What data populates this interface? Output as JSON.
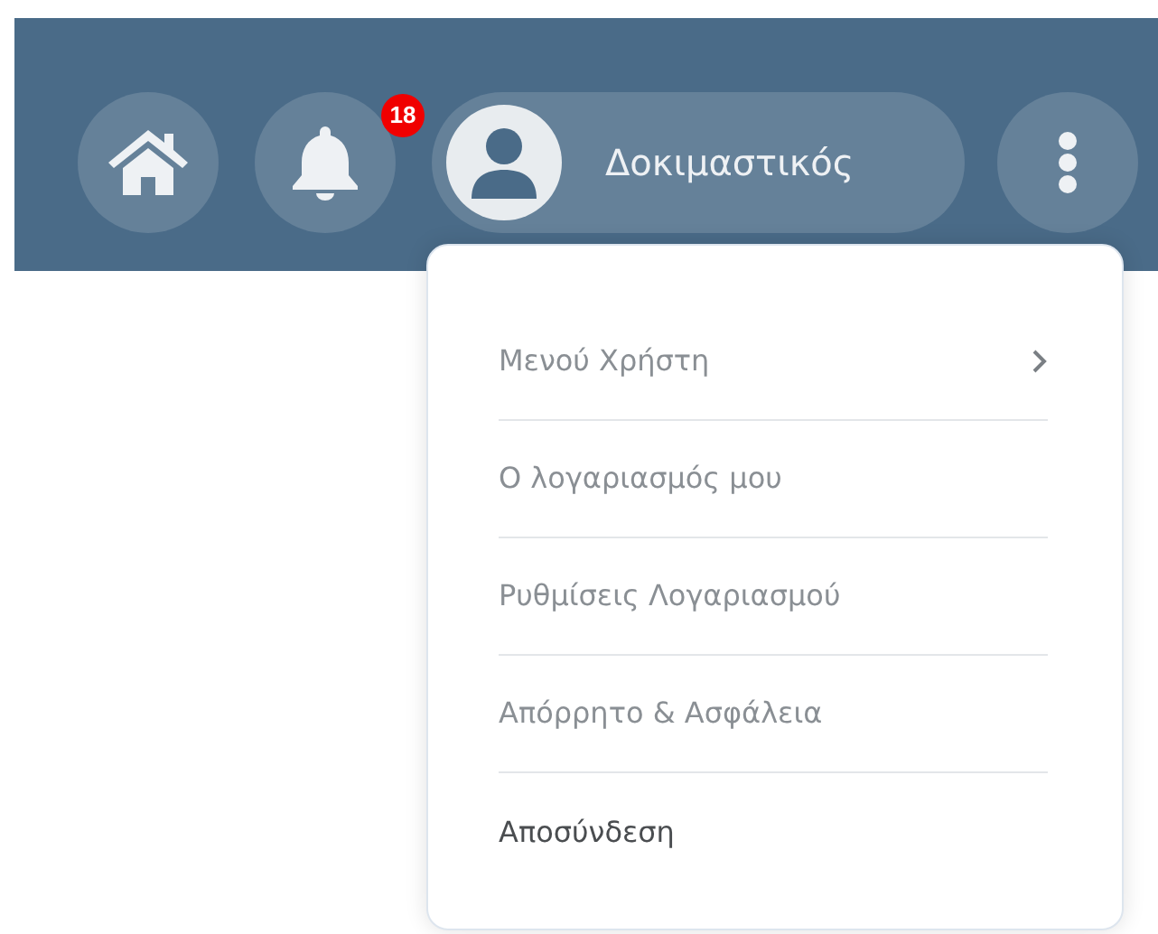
{
  "header": {
    "notifications": {
      "badge": "18"
    },
    "user": {
      "name": "Δοκιμαστικός"
    }
  },
  "user_menu": {
    "expanded": true,
    "items": [
      {
        "label": "Μενού Χρήστη",
        "kind": "submenu"
      },
      {
        "label": "Ο λογαριασμός μου",
        "kind": "link"
      },
      {
        "label": "Ρυθμίσεις Λογαριασμού",
        "kind": "link"
      },
      {
        "label": "Απόρρητο & Ασφάλεια",
        "kind": "link"
      },
      {
        "label": "Αποσύνδεση",
        "kind": "logout"
      }
    ]
  }
}
